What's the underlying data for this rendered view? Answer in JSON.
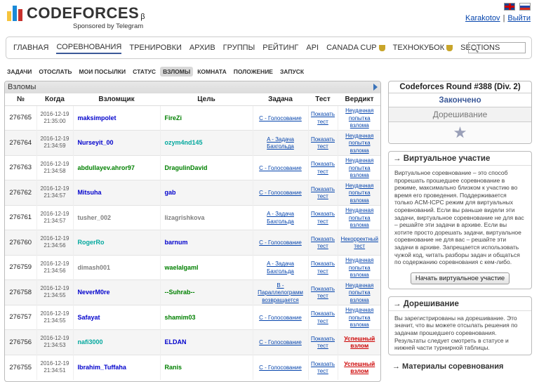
{
  "header": {
    "logo_text": "CODEFORCES",
    "logo_beta": "β",
    "sponsor": "Sponsored by Telegram",
    "user": "Karakotov",
    "separator": "|",
    "logout": "Выйти",
    "logo_colors": [
      "#f6c43d",
      "#1a8ad8",
      "#c8312d"
    ]
  },
  "menu": {
    "items": [
      {
        "label": "Главная",
        "active": false
      },
      {
        "label": "Соревнования",
        "active": true
      },
      {
        "label": "Тренировки",
        "active": false
      },
      {
        "label": "Архив",
        "active": false
      },
      {
        "label": "Группы",
        "active": false
      },
      {
        "label": "Рейтинг",
        "active": false
      },
      {
        "label": "API",
        "active": false
      },
      {
        "label": "Canada Cup",
        "active": false,
        "icon": "trophy-icon"
      },
      {
        "label": "Технокубок",
        "active": false,
        "icon": "trophy-icon"
      },
      {
        "label": "Sections",
        "active": false
      }
    ]
  },
  "submenu": {
    "items": [
      {
        "label": "Задачи",
        "active": false
      },
      {
        "label": "Отослать",
        "active": false
      },
      {
        "label": "Мои посылки",
        "active": false
      },
      {
        "label": "Статус",
        "active": false
      },
      {
        "label": "Взломы",
        "active": true
      },
      {
        "label": "Комната",
        "active": false
      },
      {
        "label": "Положение",
        "active": false
      },
      {
        "label": "Запуск",
        "active": false
      }
    ]
  },
  "hacks": {
    "title": "Взломы",
    "columns": [
      "№",
      "Когда",
      "Взломщик",
      "Цель",
      "Задача",
      "Тест",
      "Вердикт"
    ],
    "rows": [
      {
        "id": "276765",
        "when": "2016-12-19 21:35:00",
        "hacker": "maksimpolet",
        "hacker_color": "#0000cc",
        "target": "FireZi",
        "target_color": "#008000",
        "problem": "C - Голосование",
        "test": "Показать тест",
        "verdict": "Неудачная попытка взлома",
        "success": false
      },
      {
        "id": "276764",
        "when": "2016-12-19 21:34:59",
        "hacker": "Nurseyit_00",
        "hacker_color": "#0000cc",
        "target": "ozym4nd145",
        "target_color": "#03a89e",
        "problem": "A - Задача Бахгольда",
        "test": "Показать тест",
        "verdict": "Неудачная попытка взлома",
        "success": false
      },
      {
        "id": "276763",
        "when": "2016-12-19 21:34:58",
        "hacker": "abdullayev.ahror97",
        "hacker_color": "#008000",
        "target": "DragulinDavid",
        "target_color": "#008000",
        "problem": "C - Голосование",
        "test": "Показать тест",
        "verdict": "Неудачная попытка взлома",
        "success": false
      },
      {
        "id": "276762",
        "when": "2016-12-19 21:34:57",
        "hacker": "Mitsuha",
        "hacker_color": "#0000cc",
        "target": "gab",
        "target_color": "#0000cc",
        "problem": "C - Голосование",
        "test": "Показать тест",
        "verdict": "Неудачная попытка взлома",
        "success": false
      },
      {
        "id": "276761",
        "when": "2016-12-19 21:34:57",
        "hacker": "tusher_002",
        "hacker_color": "#808080",
        "target": "lizagrishkova",
        "target_color": "#808080",
        "problem": "A - Задача Бахгольда",
        "test": "Показать тест",
        "verdict": "Неудачная попытка взлома",
        "success": false
      },
      {
        "id": "276760",
        "when": "2016-12-19 21:34:56",
        "hacker": "RogerRo",
        "hacker_color": "#03a89e",
        "target": "barnum",
        "target_color": "#0000cc",
        "problem": "C - Голосование",
        "test": "Показать тест",
        "verdict": "Некорректный тест",
        "success": false
      },
      {
        "id": "276759",
        "when": "2016-12-19 21:34:56",
        "hacker": "dimash001",
        "hacker_color": "#808080",
        "target": "waelalgaml",
        "target_color": "#008000",
        "problem": "A - Задача Бахгольда",
        "test": "Показать тест",
        "verdict": "Неудачная попытка взлома",
        "success": false
      },
      {
        "id": "276758",
        "when": "2016-12-19 21:34:55",
        "hacker": "NeverM0re",
        "hacker_color": "#0000cc",
        "target": "--Suhrab--",
        "target_color": "#008000",
        "problem": "B - Параллелограмм возвращается",
        "test": "Показать тест",
        "verdict": "Неудачная попытка взлома",
        "success": false
      },
      {
        "id": "276757",
        "when": "2016-12-19 21:34:55",
        "hacker": "Safayat",
        "hacker_color": "#0000cc",
        "target": "shamim03",
        "target_color": "#008000",
        "problem": "C - Голосование",
        "test": "Показать тест",
        "verdict": "Неудачная попытка взлома",
        "success": false
      },
      {
        "id": "276756",
        "when": "2016-12-19 21:34:53",
        "hacker": "nafi3000",
        "hacker_color": "#03a89e",
        "target": "ELDAN",
        "target_color": "#0000cc",
        "problem": "C - Голосование",
        "test": "Показать тест",
        "verdict": "Успешный взлом",
        "success": true
      },
      {
        "id": "276755",
        "when": "2016-12-19 21:34:51",
        "hacker": "Ibrahim_Tuffaha",
        "hacker_color": "#0000cc",
        "target": "Ranis",
        "target_color": "#008000",
        "problem": "C - Голосование",
        "test": "Показать тест",
        "verdict": "Успешный взлом",
        "success": true
      }
    ]
  },
  "sidebar": {
    "contest_title": "Codeforces Round #388 (Div. 2)",
    "contest_status": "Закончено",
    "contest_phase": "Дорешивание",
    "virtual_head": "→ Виртуальное участие",
    "virtual_text": "Виртуальное соревнование – это способ прорешать прошедшее соревнование в режиме, максимально близком к участию во время его проведения. Поддерживается только ACM-ICPC режим для виртуальных соревнований. Если вы раньше видели эти задачи, виртуальное соревнование не для вас – решайте эти задачи в архиве. Если вы хотите просто дорешать задачи, виртуальное соревнование не для вас – решайте эти задачи в архиве. Запрещается использовать чужой код, читать разборы задач и общаться по содержанию соревнования с кем-либо.",
    "virtual_button": "Начать виртуальное участие",
    "practice_head": "→ Дорешивание",
    "practice_text": "Вы зарегистрированы на дорешивание. Это значит, что вы можете отсылать решения по задачам прошедшего соревнования. Результаты следует смотреть в статусе и нижней части турнирной таблицы.",
    "materials_head": "→ Материалы соревнования"
  }
}
